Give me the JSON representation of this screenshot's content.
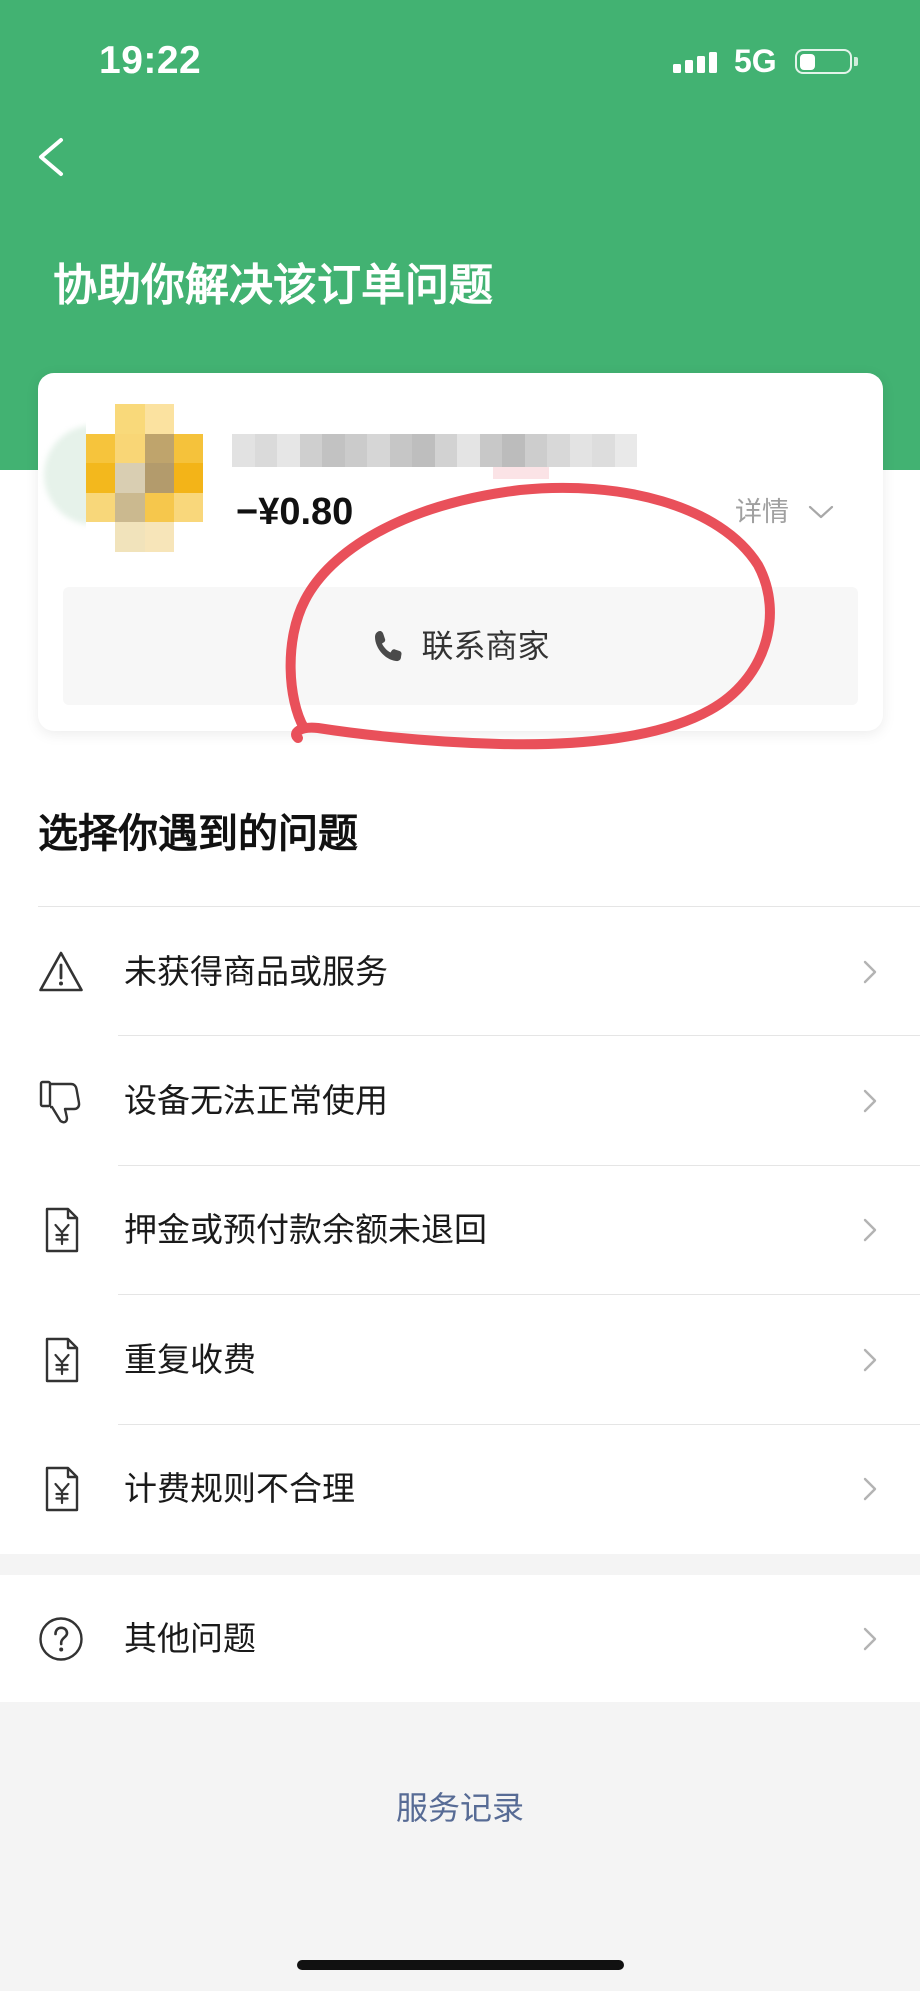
{
  "status_bar": {
    "time": "19:22",
    "network": "5G",
    "signal_level": 4,
    "battery_level": 0.33
  },
  "header": {
    "title": "协助你解决该订单问题",
    "back_icon": "back-chevron-icon"
  },
  "order_card": {
    "amount": "−¥0.80",
    "details_label": "详情",
    "details_icon": "chevron-down-icon",
    "contact_label": "联系商家",
    "contact_icon": "phone-icon"
  },
  "problems": {
    "heading": "选择你遇到的问题",
    "items": [
      {
        "label": "未获得商品或服务",
        "icon": "warning-icon"
      },
      {
        "label": "设备无法正常使用",
        "icon": "thumbs-down-icon"
      },
      {
        "label": "押金或预付款余额未退回",
        "icon": "yuan-document-icon"
      },
      {
        "label": "重复收费",
        "icon": "yuan-document-icon"
      },
      {
        "label": "计费规则不合理",
        "icon": "yuan-document-icon"
      }
    ],
    "other": {
      "label": "其他问题",
      "icon": "question-circle-icon"
    }
  },
  "footer": {
    "service_records_label": "服务记录"
  },
  "colors": {
    "brand_green": "#42B272",
    "link_blue": "#576B95",
    "annotation_red": "#E9505A",
    "background_gray": "#F4F4F4"
  }
}
